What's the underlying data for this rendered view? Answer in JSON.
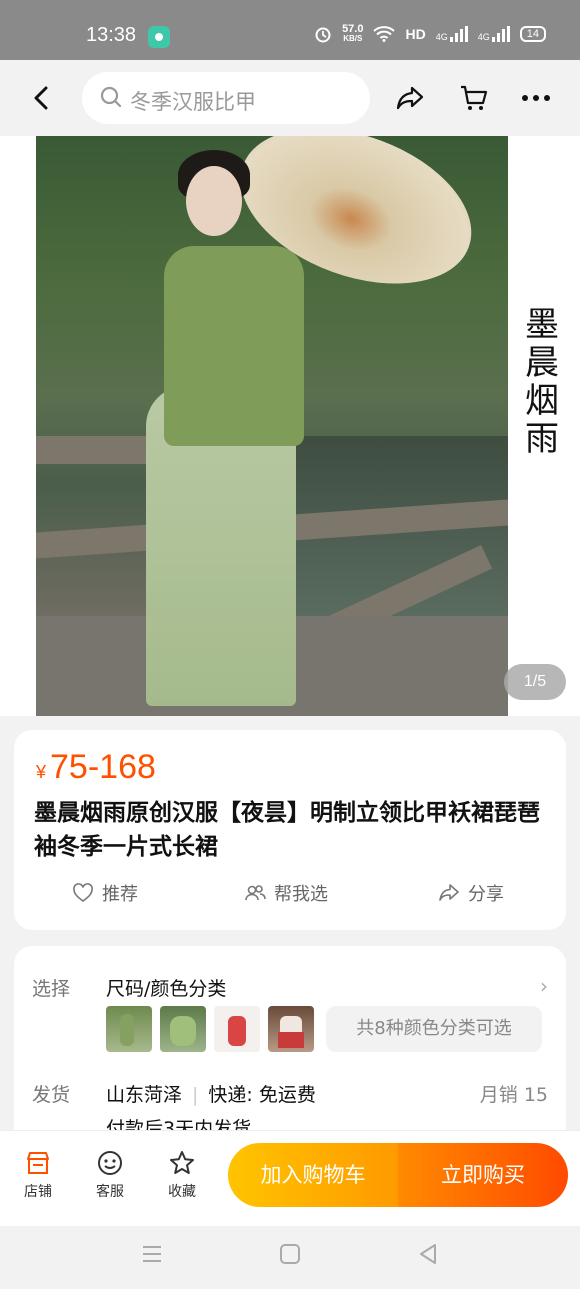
{
  "status": {
    "time": "13:38",
    "net_speed": "57.0",
    "net_unit": "KB/S",
    "hd": "HD",
    "sig1": "4G",
    "sig2": "4G",
    "battery": "14"
  },
  "nav": {
    "search_placeholder": "冬季汉服比甲"
  },
  "gallery": {
    "overlay_text": "墨晨烟雨",
    "counter": "1/5"
  },
  "product": {
    "currency": "¥",
    "price": "75-168",
    "title": "墨晨烟雨原创汉服【夜昙】明制立领比甲袄裙琵琶袖冬季一片式长裙",
    "actions": {
      "recommend": "推荐",
      "help_choose": "帮我选",
      "share": "分享"
    }
  },
  "options": {
    "select_label": "选择",
    "select_value": "尺码/颜色分类",
    "variant_summary": "共8种颜色分类可选",
    "ship_label": "发货",
    "ship_from": "山东菏泽",
    "express": "快递: 免运费",
    "monthly_sales": "月销  15",
    "ship_time": "付款后3天内发货"
  },
  "bottom": {
    "store": "店铺",
    "service": "客服",
    "favorite": "收藏",
    "add_to_cart": "加入购物车",
    "buy_now": "立即购买"
  },
  "colors": {
    "accent": "#ff5000",
    "cart_gradient": [
      "#ffc400",
      "#ff9a00"
    ],
    "buy_gradient": [
      "#ff8a00",
      "#ff4a00"
    ]
  }
}
